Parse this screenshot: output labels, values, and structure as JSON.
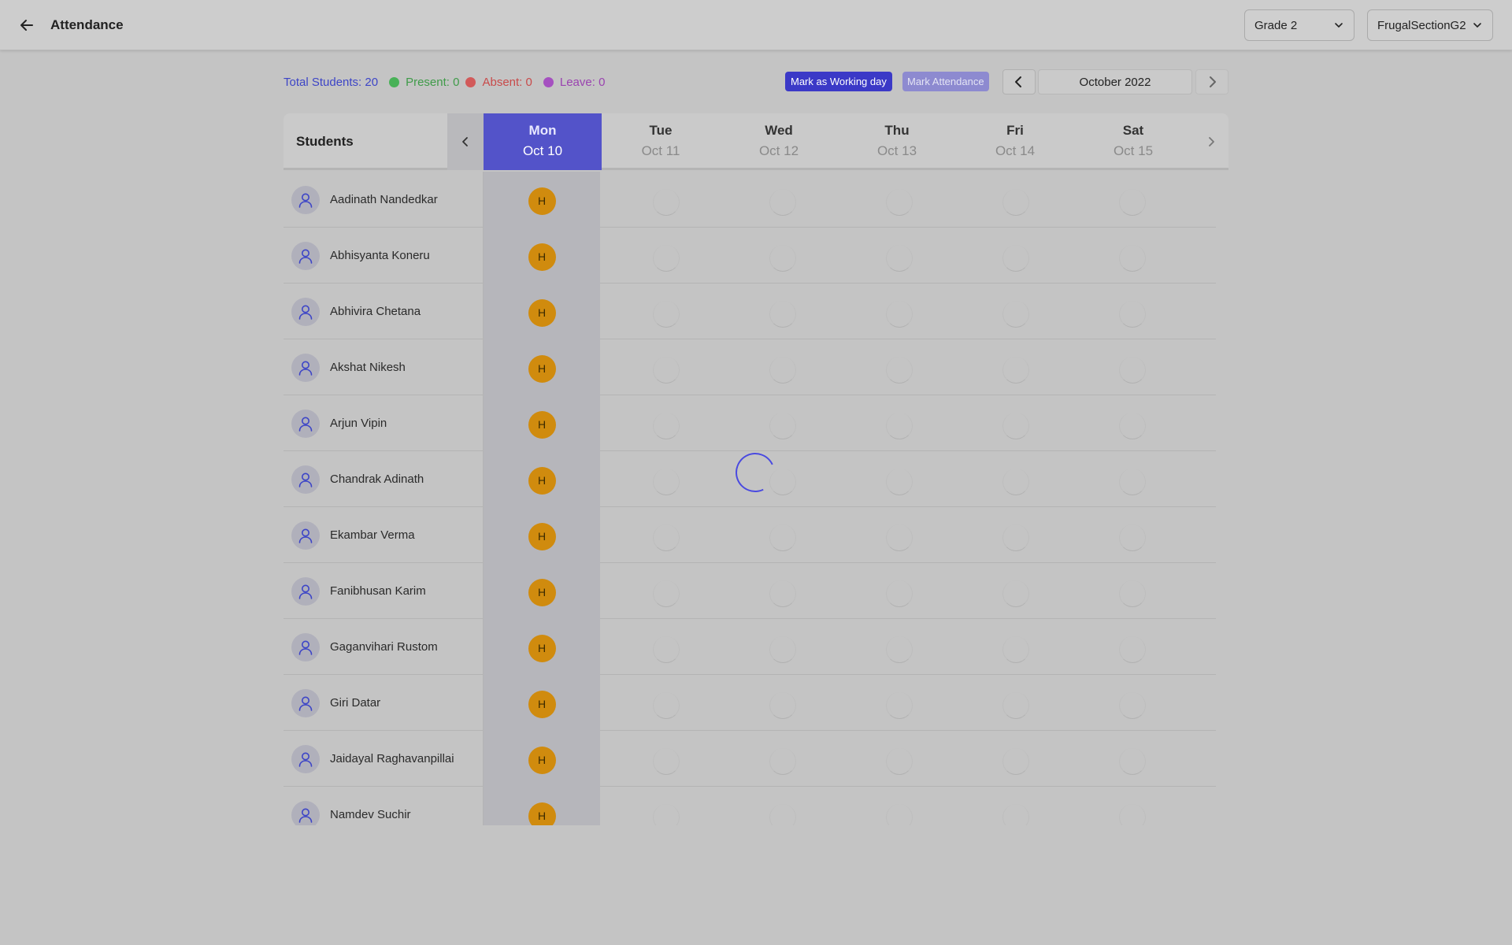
{
  "header": {
    "title": "Attendance",
    "grade_select": "Grade 2",
    "section_select": "FrugalSectionG2"
  },
  "stats": {
    "total": "Total Students: 20",
    "present": "Present: 0",
    "absent": "Absent: 0",
    "leave": "Leave: 0"
  },
  "colors": {
    "accent": "#5353c9",
    "present": "#3f9b49",
    "absent": "#c84a4a",
    "leave": "#9a43b0",
    "holiday": "#d08b0e"
  },
  "actions": {
    "mark_working_day": "Mark as Working day",
    "mark_attendance": "Mark Attendance"
  },
  "month": {
    "label": "October 2022"
  },
  "grid": {
    "students_header": "Students",
    "days": [
      {
        "name": "Mon",
        "date": "Oct 10",
        "active": true
      },
      {
        "name": "Tue",
        "date": "Oct 11",
        "active": false
      },
      {
        "name": "Wed",
        "date": "Oct 12",
        "active": false
      },
      {
        "name": "Thu",
        "date": "Oct 13",
        "active": false
      },
      {
        "name": "Fri",
        "date": "Oct 14",
        "active": false
      },
      {
        "name": "Sat",
        "date": "Oct 15",
        "active": false
      }
    ],
    "holiday_mark": "H",
    "students": [
      "Aadinath Nandedkar",
      "Abhisyanta Koneru",
      "Abhivira Chetana",
      "Akshat Nikesh",
      "Arjun Vipin",
      "Chandrak Adinath",
      "Ekambar Verma",
      "Fanibhusan Karim",
      "Gaganvihari Rustom",
      "Giri Datar",
      "Jaidayal Raghavanpillai",
      "Namdev Suchir"
    ]
  }
}
